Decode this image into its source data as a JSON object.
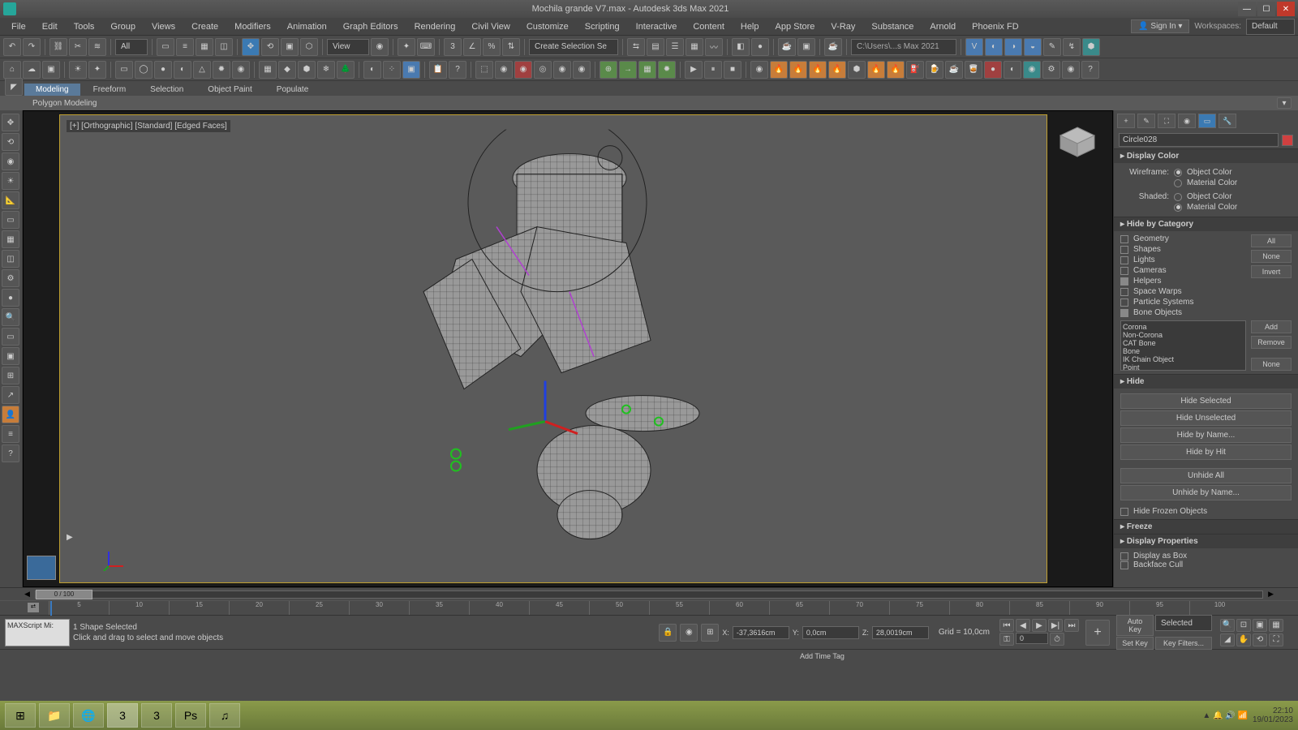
{
  "title": "Mochila grande V7.max - Autodesk 3ds Max 2021",
  "menus": [
    "File",
    "Edit",
    "Tools",
    "Group",
    "Views",
    "Create",
    "Modifiers",
    "Animation",
    "Graph Editors",
    "Rendering",
    "Civil View",
    "Customize",
    "Scripting",
    "Interactive",
    "Content",
    "Help",
    "App Store",
    "V-Ray",
    "Substance",
    "Arnold",
    "Phoenix FD"
  ],
  "signin": "Sign In",
  "workspaces_label": "Workspaces:",
  "workspace": "Default",
  "toolbar_dropdown1": "All",
  "toolbar_view": "View",
  "selection_set": "Create Selection Se",
  "path_input": "C:\\Users\\...s Max 2021",
  "ribbon_tabs": [
    "Modeling",
    "Freeform",
    "Selection",
    "Object Paint",
    "Populate"
  ],
  "ribbon_sub": "Polygon Modeling",
  "viewport_label": "[+] [Orthographic] [Standard] [Edged Faces]",
  "object_name": "Circle028",
  "rollout_display_color": "Display Color",
  "wireframe_label": "Wireframe:",
  "shaded_label": "Shaded:",
  "color_options": [
    "Object Color",
    "Material Color"
  ],
  "rollout_hide_category": "Hide by Category",
  "categories": [
    "Geometry",
    "Shapes",
    "Lights",
    "Cameras",
    "Helpers",
    "Space Warps",
    "Particle Systems",
    "Bone Objects"
  ],
  "cat_btns": {
    "all": "All",
    "none": "None",
    "invert": "Invert"
  },
  "plugin_list": [
    "Corona",
    "Non-Corona",
    "CAT Bone",
    "Bone",
    "IK Chain Object",
    "Point"
  ],
  "plugin_btns": {
    "add": "Add",
    "remove": "Remove",
    "none": "None"
  },
  "rollout_hide": "Hide",
  "hide_btns": [
    "Hide Selected",
    "Hide Unselected",
    "Hide by Name...",
    "Hide by Hit",
    "Unhide All",
    "Unhide by Name...",
    "Hide Frozen Objects"
  ],
  "rollout_freeze": "Freeze",
  "rollout_display_props": "Display Properties",
  "display_prop_items": [
    "Display as Box",
    "Backface Cull"
  ],
  "timeline_text": "0 / 100",
  "ruler_marks": [
    "5",
    "10",
    "15",
    "20",
    "25",
    "30",
    "35",
    "40",
    "45",
    "50",
    "55",
    "60",
    "65",
    "70",
    "75",
    "80",
    "85",
    "90",
    "95",
    "100"
  ],
  "script_label": "MAXScript Mi:",
  "status_line1": "1 Shape Selected",
  "status_line2": "Click and drag to select and move objects",
  "coords": {
    "x": "-37,3616cm",
    "y": "0,0cm",
    "z": "28,0019cm"
  },
  "grid": "Grid = 10,0cm",
  "add_time_tag": "Add Time Tag",
  "auto_key": "Auto Key",
  "set_key": "Set Key",
  "selected": "Selected",
  "key_filters": "Key Filters...",
  "frame_input": "0",
  "clock_time": "22:10",
  "clock_date": "19/01/2023"
}
